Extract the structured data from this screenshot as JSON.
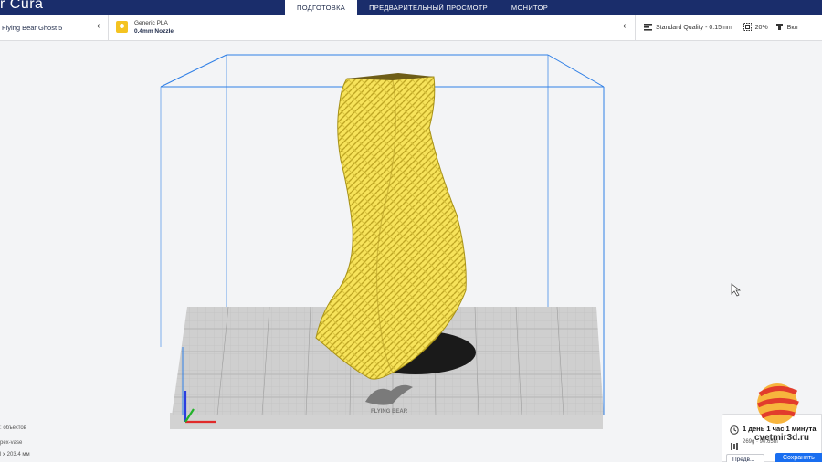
{
  "app": {
    "title": "r Cura"
  },
  "stages": [
    {
      "label": "ПОДГОТОВКА"
    },
    {
      "label": "ПРЕДВАРИТЕЛЬНЫЙ ПРОСМОТР"
    },
    {
      "label": "МОНИТОР"
    }
  ],
  "printer": {
    "name": "Flying Bear Ghost 5"
  },
  "material": {
    "name": "Generic PLA",
    "nozzle": "0.4mm Nozzle",
    "badge_color": "#f4c320"
  },
  "print_settings": {
    "profile": "Standard Quality - 0.15mm",
    "infill": "20%",
    "support": "Вкл"
  },
  "object_info": {
    "objects_line": ": объектов",
    "name_line": "pex-vase",
    "dims_line": "l x 203.4 мм"
  },
  "estimate": {
    "time": "1 день 1 час 1 минута",
    "material": "269g · 90.65m"
  },
  "actions": {
    "preview_label": "Предв...",
    "save_label": "Сохранить"
  },
  "watermark": {
    "text": "cvetmir3d.ru"
  },
  "bed": {
    "logo_text": "FLYING BEAR"
  },
  "colors": {
    "topbar": "#1a2d6b",
    "model": "#f5e35d",
    "build_volume": "#2f7fe6",
    "save_button": "#196ef0"
  }
}
